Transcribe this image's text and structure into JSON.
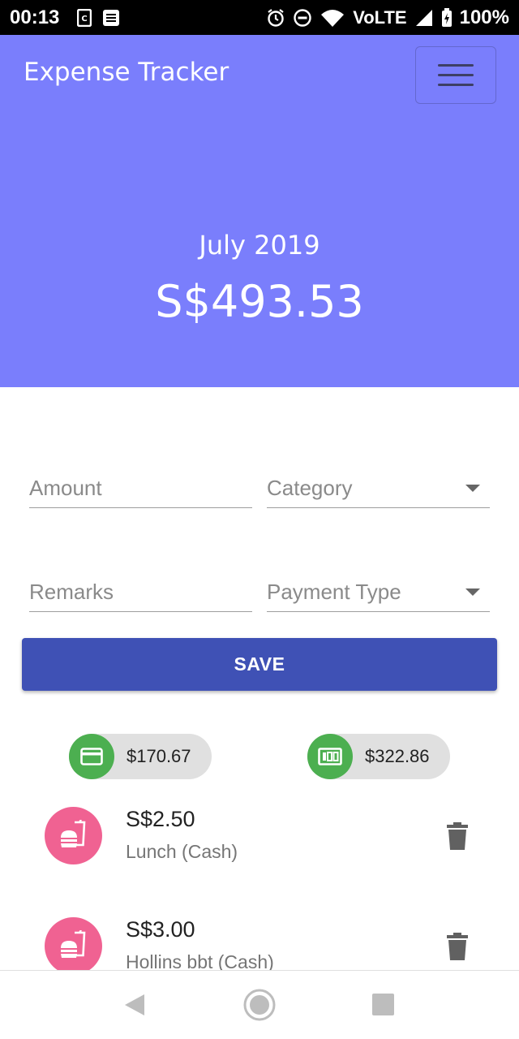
{
  "status_bar": {
    "time": "00:13",
    "network": "VoLTE",
    "battery": "100%"
  },
  "header": {
    "app_title": "Expense Tracker",
    "month": "July 2019",
    "total": "S$493.53"
  },
  "form": {
    "amount_placeholder": "Amount",
    "category_placeholder": "Category",
    "remarks_placeholder": "Remarks",
    "payment_type_placeholder": "Payment Type",
    "save_label": "SAVE"
  },
  "summary_chips": [
    {
      "icon": "credit-card-icon",
      "amount": "$170.67"
    },
    {
      "icon": "cash-icon",
      "amount": "$322.86"
    }
  ],
  "expenses": [
    {
      "icon": "fastfood-icon",
      "amount": "S$2.50",
      "description": "Lunch (Cash)"
    },
    {
      "icon": "fastfood-icon",
      "amount": "S$3.00",
      "description": "Hollins bbt (Cash)"
    }
  ],
  "colors": {
    "header_bg": "#7a7efc",
    "primary": "#3f51b5",
    "chip_icon": "#4caf50",
    "category_icon": "#f06292"
  }
}
